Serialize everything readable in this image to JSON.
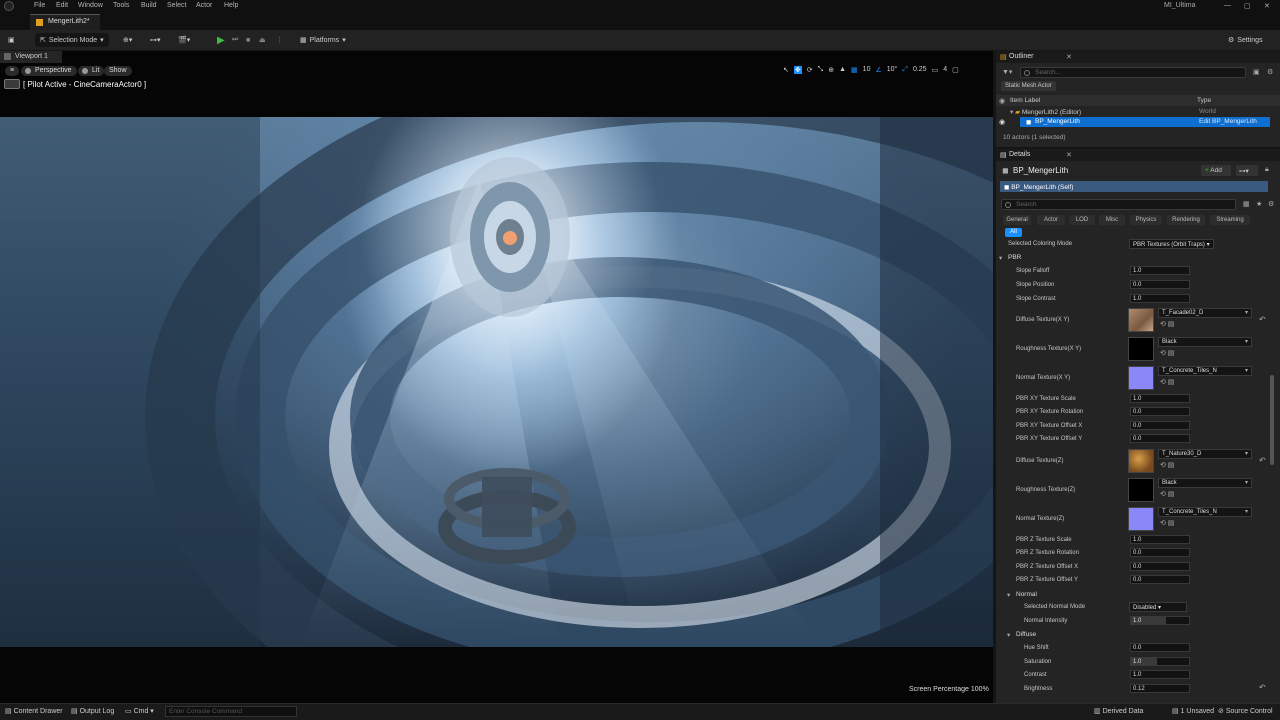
{
  "menu": {
    "items": [
      "File",
      "Edit",
      "Window",
      "Tools",
      "Build",
      "Select",
      "Actor",
      "Help"
    ],
    "project": "MI_Ultima"
  },
  "doc_tab": {
    "label": "MengerLith2*"
  },
  "toolbar": {
    "selection_mode": "Selection Mode",
    "platforms": "Platforms",
    "settings": "Settings"
  },
  "viewport": {
    "tab": "Viewport 1",
    "perspective": "Perspective",
    "lit": "Lit",
    "show": "Show",
    "pilot": "[ Pilot Active - CineCameraActor0 ]",
    "grid_snap": "10",
    "rot_snap": "10°",
    "scale_snap": "0.25",
    "cam_speed": "4",
    "screen_percentage": "Screen Percentage",
    "screen_pct_value": "100%"
  },
  "outliner": {
    "title": "Outliner",
    "search_placeholder": "Search...",
    "filter_chip": "Static Mesh Actor",
    "col_label": "Item Label",
    "col_type": "Type",
    "row1_label": "MengerLith2 (Editor)",
    "row1_type": "World",
    "row2_label": "BP_MengerLith",
    "row2_type": "Edit BP_MengerLith",
    "count": "10 actors (1 selected)"
  },
  "details": {
    "title": "Details",
    "actor_name": "BP_MengerLith",
    "add_label": "Add",
    "component": "BP_MengerLith (Self)",
    "search_placeholder": "Search",
    "tabs": [
      "General",
      "Actor",
      "LOD",
      "Misc",
      "Physics",
      "Rendering",
      "Streaming"
    ],
    "all_tab": "All",
    "coloring_label": "Selected Coloring Mode",
    "coloring_value": "PBR Textures (Orbit Traps)",
    "pbr": "PBR",
    "slope_falloff": {
      "label": "Slope Falloff",
      "value": "1.0"
    },
    "slope_position": {
      "label": "Slope Position",
      "value": "0.0"
    },
    "slope_contrast": {
      "label": "Slope Contrast",
      "value": "1.0"
    },
    "diffuse_xy": {
      "label": "Diffuse Texture(X Y)",
      "value": "T_Facade02_D"
    },
    "rough_xy": {
      "label": "Roughness Texture(X Y)",
      "value": "Black"
    },
    "normal_xy": {
      "label": "Normal Texture(X Y)",
      "value": "T_Concrete_Tiles_N"
    },
    "xy_scale": {
      "label": "PBR XY Texture Scale",
      "value": "1.0"
    },
    "xy_rot": {
      "label": "PBR XY Texture Rotation",
      "value": "0.0"
    },
    "xy_offx": {
      "label": "PBR XY Texture Offset X",
      "value": "0.0"
    },
    "xy_offy": {
      "label": "PBR XY Texture Offset Y",
      "value": "0.0"
    },
    "diffuse_z": {
      "label": "Diffuse Texture(Z)",
      "value": "T_Nature30_D"
    },
    "rough_z": {
      "label": "Roughness Texture(Z)",
      "value": "Black"
    },
    "normal_z": {
      "label": "Normal Texture(Z)",
      "value": "T_Concrete_Tiles_N"
    },
    "z_scale": {
      "label": "PBR Z Texture Scale",
      "value": "1.0"
    },
    "z_rot": {
      "label": "PBR Z Texture Rotation",
      "value": "0.0"
    },
    "z_offx": {
      "label": "PBR Z Texture Offset X",
      "value": "0.0"
    },
    "z_offy": {
      "label": "PBR Z Texture Offset Y",
      "value": "0.0"
    },
    "normal_section": "Normal",
    "normal_mode": {
      "label": "Selected Normal Mode",
      "value": "Disabled"
    },
    "normal_intensity": {
      "label": "Normal Intensity",
      "value": "1.0"
    },
    "diffuse_section": "Diffuse",
    "hue_shift": {
      "label": "Hue Shift",
      "value": "0.0"
    },
    "saturation": {
      "label": "Saturation",
      "value": "1.0"
    },
    "contrast": {
      "label": "Contrast",
      "value": "1.0"
    },
    "brightness": {
      "label": "Brightness",
      "value": "0.12"
    }
  },
  "status": {
    "content_drawer": "Content Drawer",
    "output_log": "Output Log",
    "cmd": "Cmd",
    "cmd_placeholder": "Enter Console Command",
    "derived_data": "Derived Data",
    "unsaved": "1 Unsaved",
    "source_control": "Source Control"
  },
  "colors": {
    "selection": "#0f6fd1",
    "play": "#3fbf3f",
    "accent_tab": "#1a8fff"
  }
}
